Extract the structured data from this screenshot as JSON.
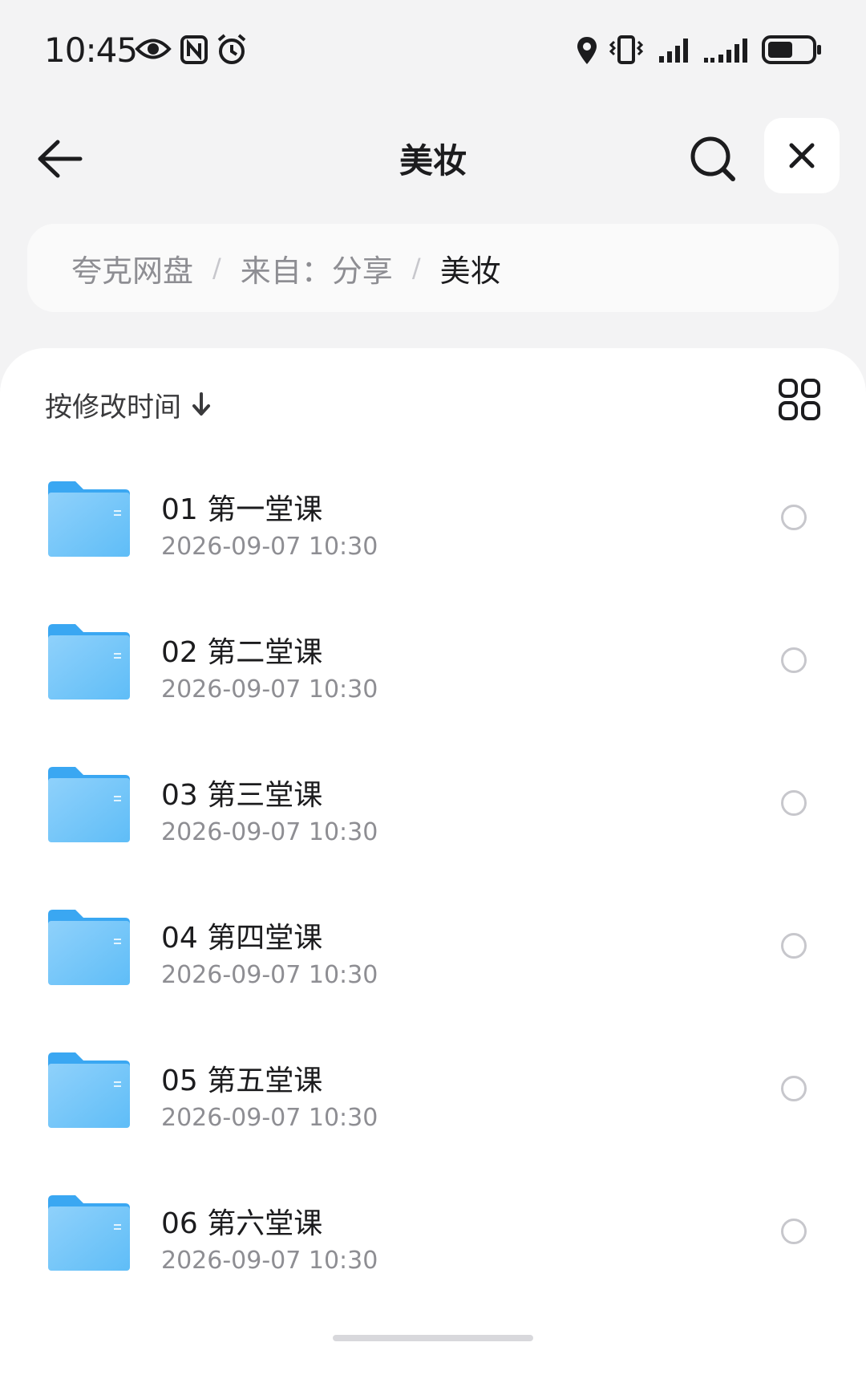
{
  "status_bar": {
    "time": "10:45",
    "left_icons": [
      "eye-icon",
      "nfc-icon",
      "alarm-icon"
    ],
    "right_icons": [
      "location-icon",
      "vibrate-icon",
      "signal-icon",
      "signal-icon",
      "battery-icon"
    ]
  },
  "header": {
    "title": "美妆",
    "back_icon": "arrow-left-icon",
    "search_icon": "search-icon",
    "close_icon": "close-icon"
  },
  "breadcrumb": {
    "items": [
      "夸克网盘",
      "来自：分享",
      "美妆"
    ],
    "separator": "/"
  },
  "sort": {
    "label": "按修改时间",
    "direction_icon": "arrow-down-icon",
    "view_toggle_icon": "grid-view-icon"
  },
  "files": [
    {
      "name": "01 第一堂课",
      "date": "2026-09-07 10:30",
      "icon": "folder-icon"
    },
    {
      "name": "02 第二堂课",
      "date": "2026-09-07 10:30",
      "icon": "folder-icon"
    },
    {
      "name": "03 第三堂课",
      "date": "2026-09-07 10:30",
      "icon": "folder-icon"
    },
    {
      "name": "04 第四堂课",
      "date": "2026-09-07 10:30",
      "icon": "folder-icon"
    },
    {
      "name": "05 第五堂课",
      "date": "2026-09-07 10:30",
      "icon": "folder-icon"
    },
    {
      "name": "06 第六堂课",
      "date": "2026-09-07 10:30",
      "icon": "folder-icon"
    }
  ],
  "colors": {
    "background": "#f3f3f4",
    "card": "#ffffff",
    "folder_blue": "#4fb3f6",
    "text_primary": "#1c1c1e",
    "text_secondary": "#8e8e93"
  }
}
